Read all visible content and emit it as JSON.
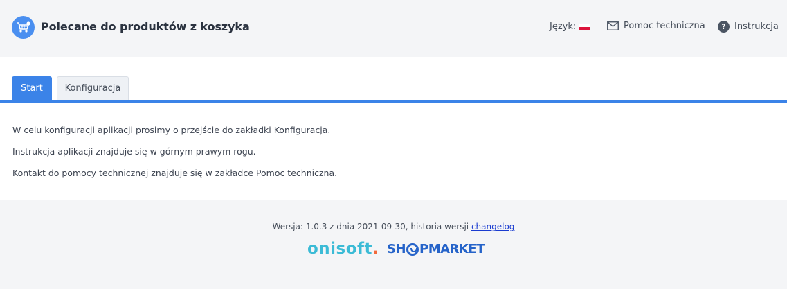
{
  "header": {
    "app_title": "Polecane do produktów z koszyka",
    "app_icon": "shopping-cart-icon",
    "language_label": "Język:",
    "language_flag": "pl-flag",
    "help_label": "Pomoc techniczna",
    "help_icon": "envelope-icon",
    "instructions_label": "Instrukcja",
    "instructions_icon": "question-circle-icon"
  },
  "tabs": [
    {
      "label": "Start",
      "active": true
    },
    {
      "label": "Konfiguracja",
      "active": false
    }
  ],
  "content": {
    "lines": [
      "W celu konfiguracji aplikacji prosimy o przejście do zakładki Konfiguracja.",
      "Instrukcja aplikacji znajduje się w górnym prawym rogu.",
      "Kontakt do pomocy technicznej znajduje się w zakładce Pomoc techniczna."
    ]
  },
  "footer": {
    "version_text": "Wersja: 1.0.3 z dnia 2021-09-30, historia wersji",
    "changelog_link": "changelog",
    "logo_onisoft": "onisoft",
    "logo_onisoft_dot": ".",
    "logo_shop_prefix": "SH",
    "logo_shop_suffix": "PMARKET"
  },
  "colors": {
    "accent": "#3b83e8",
    "app_icon_bg": "#4a8ff0",
    "onisoft": "#3bbbd6",
    "onisoft_dot": "#f26a3d",
    "shopmarket": "#2563c9",
    "link": "#1a3cd0"
  }
}
